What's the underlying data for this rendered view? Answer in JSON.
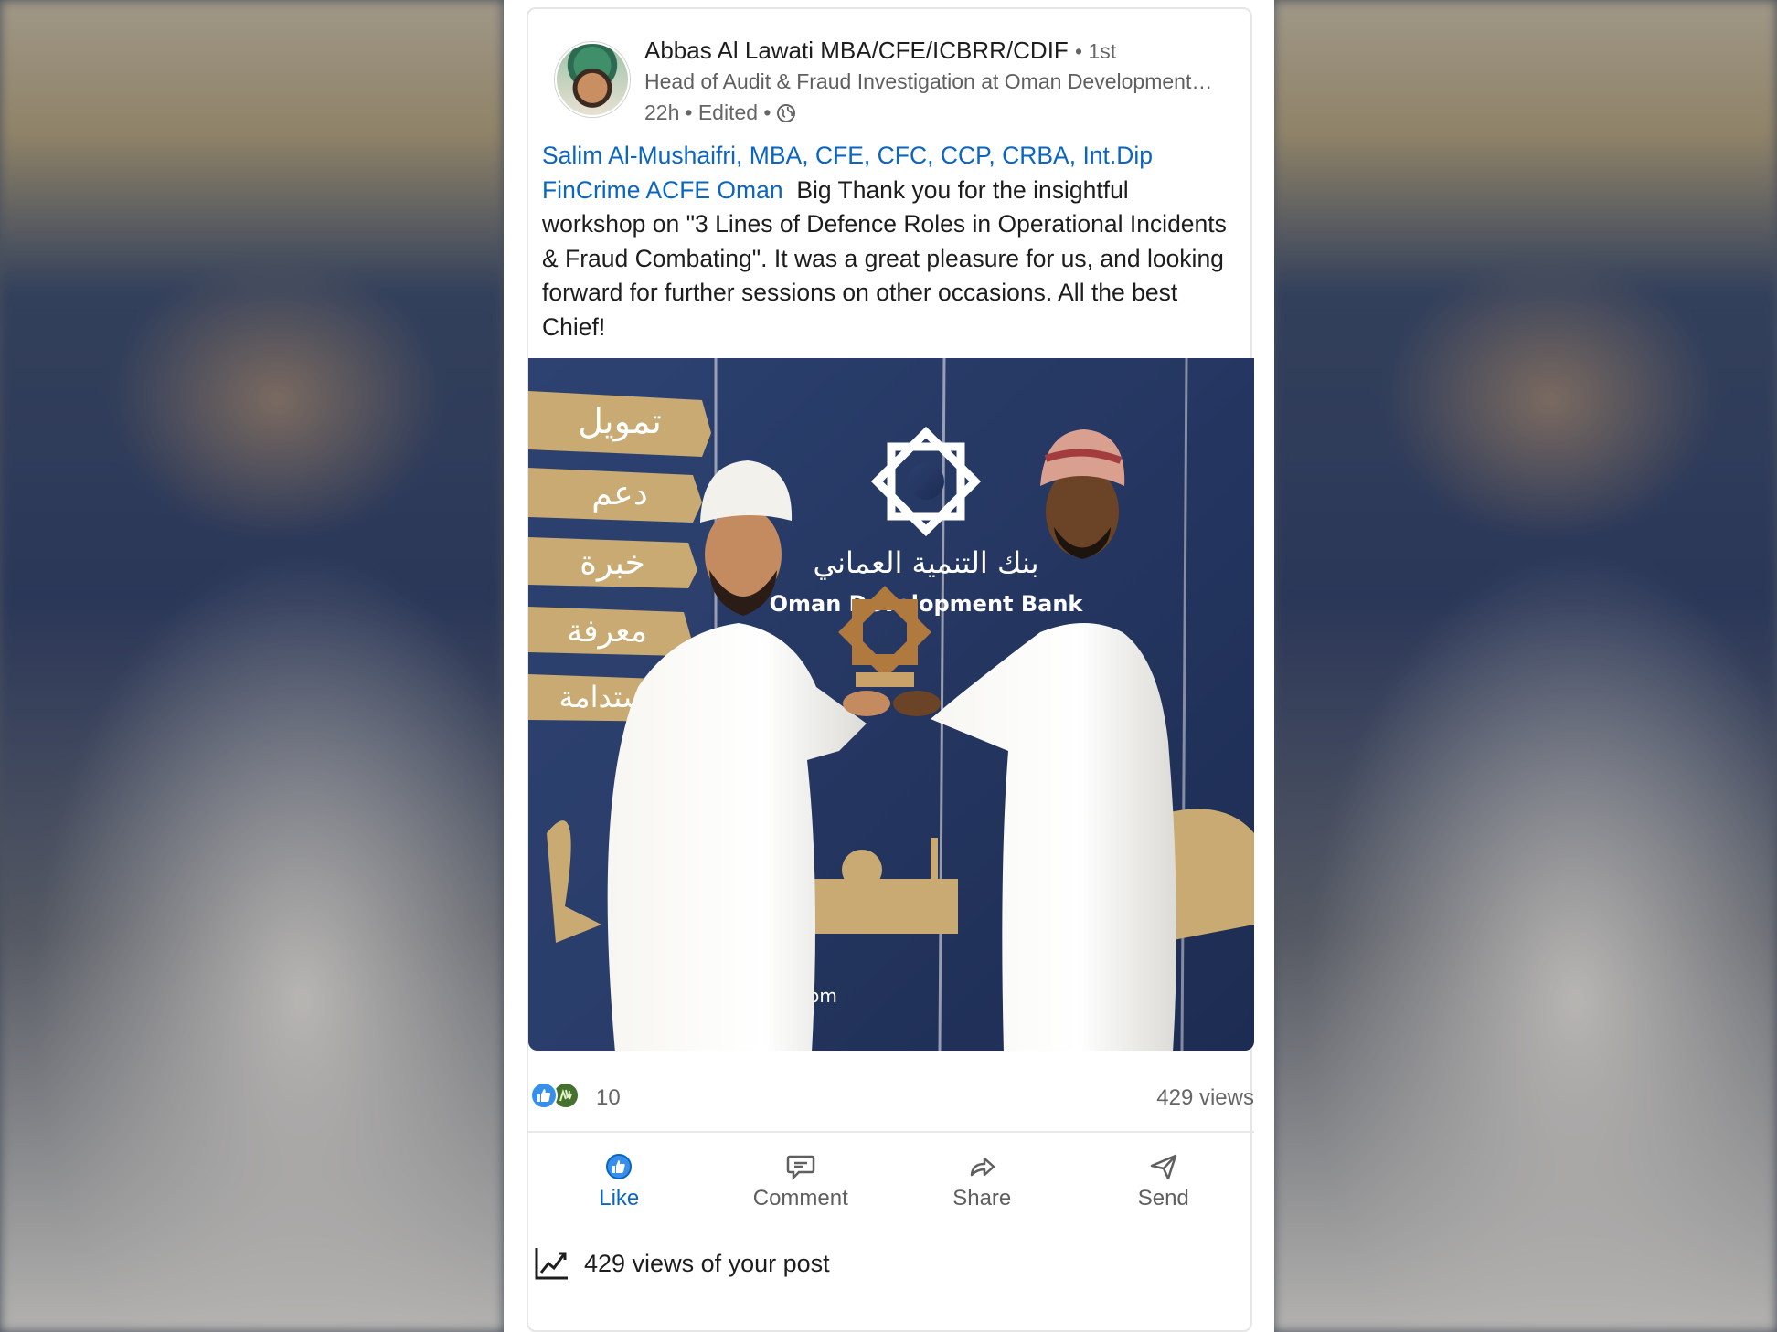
{
  "post": {
    "author": {
      "name": "Abbas Al Lawati MBA/CFE/ICBRR/CDIF",
      "degree": "• 1st",
      "headline": "Head of Audit & Fraud Investigation at Oman Development…",
      "time": "22h",
      "edited": "• Edited •"
    },
    "mentions": {
      "person": "Salim Al-Mushaifri, MBA, CFE, CFC, CCP, CRBA, Int.Dip FinCrime",
      "org": "ACFE Oman"
    },
    "body": "Big Thank you for the insightful workshop on \"3 Lines of Defence Roles in Operational Incidents & Fraud Combating\". It was a great pleasure for us, and looking forward for further sessions on other occasions. All the best Chief!",
    "photo": {
      "backdrop_arabic_words": [
        "تمويل",
        "دعم",
        "خبرة",
        "معرفة",
        "استدامة"
      ],
      "bank_name_arabic": "بنك التنمية العماني",
      "bank_name_english": "Oman Development Bank",
      "website": "odb.om"
    },
    "reactions": {
      "count": "10",
      "views": "429 views",
      "icons": [
        "like-icon",
        "celebrate-icon"
      ]
    },
    "actions": {
      "like": "Like",
      "comment": "Comment",
      "share": "Share",
      "send": "Send"
    },
    "analytics": {
      "text": "429 views of your post"
    }
  },
  "colors": {
    "link": "#0a66c2",
    "text": "#1d1d1d",
    "muted": "#666666",
    "like_reaction": "#378fe9",
    "celebrate_reaction": "#44712e",
    "banner_navy": "#263865",
    "banner_gold": "#c8aa72"
  }
}
